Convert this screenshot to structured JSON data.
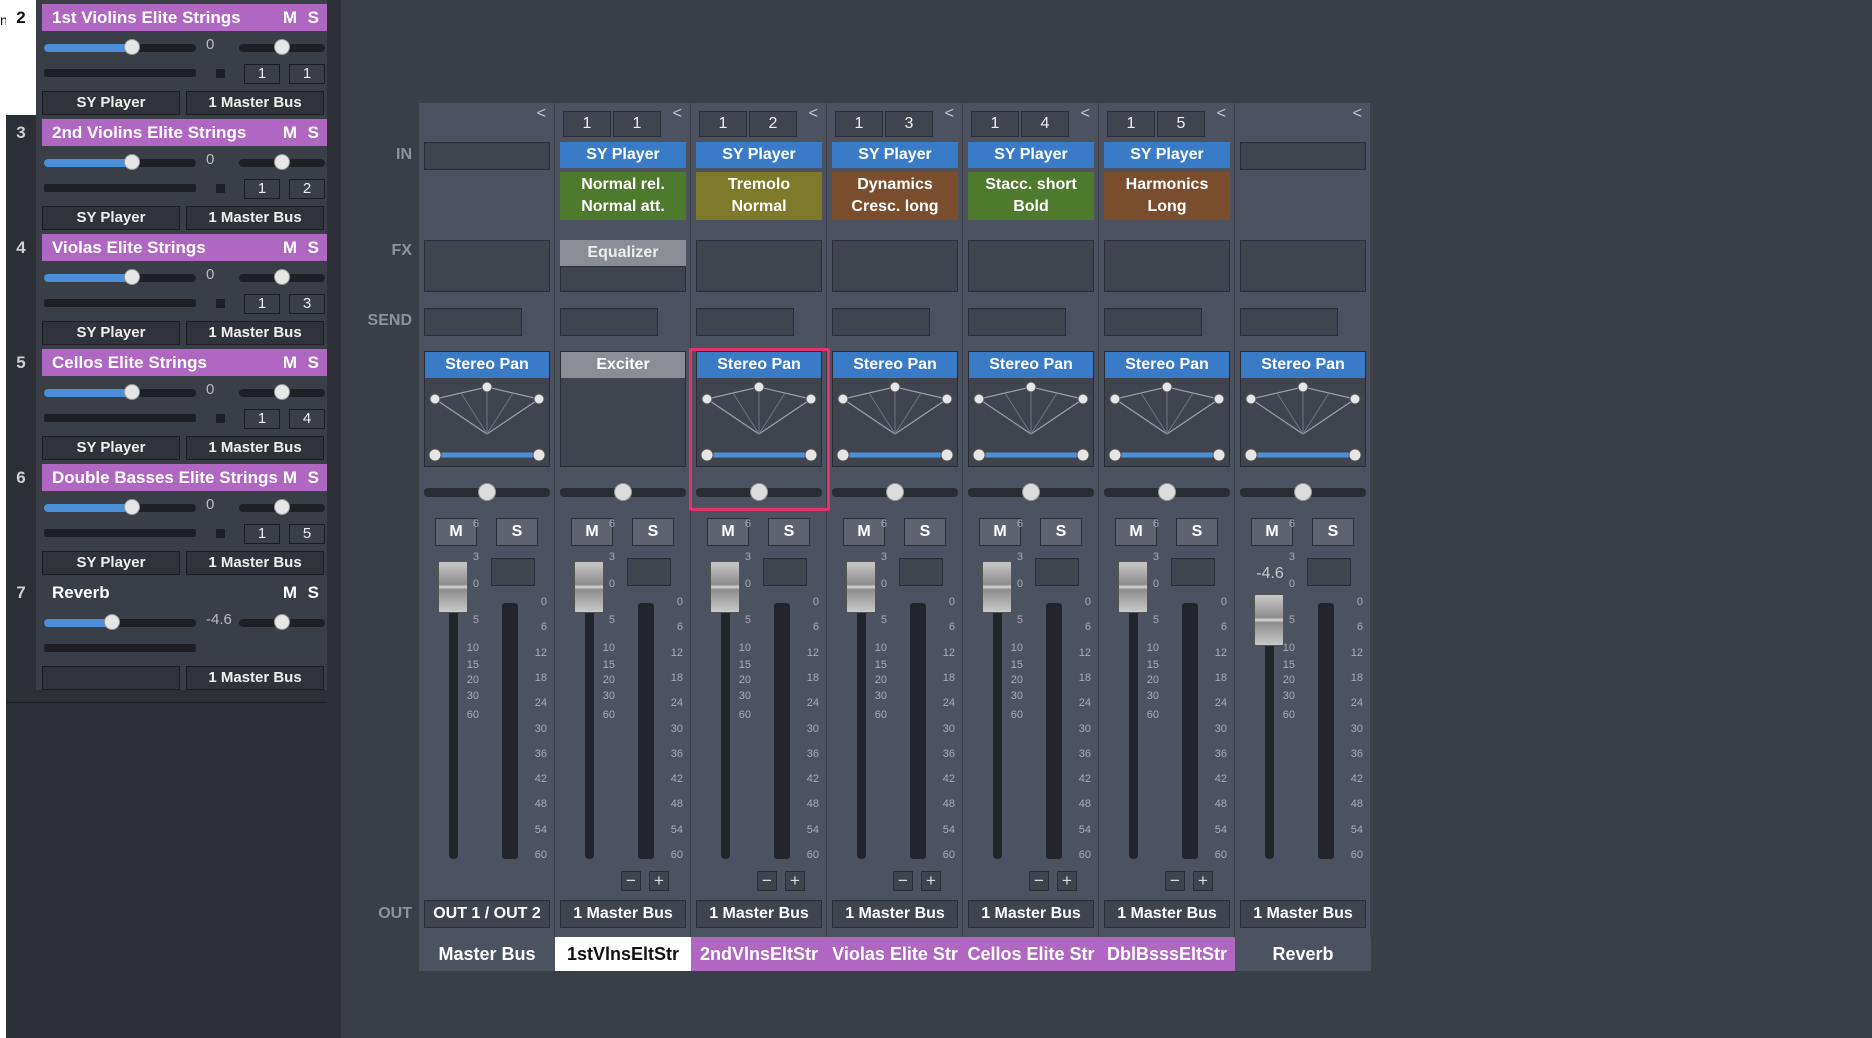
{
  "edge_text": "n",
  "tracks": [
    {
      "num": "2",
      "name": "1st Violins Elite Strings",
      "vol": "0",
      "ch_a": "1",
      "ch_b": "1",
      "input": "SY Player",
      "output": "1 Master Bus",
      "mute": "M",
      "solo": "S"
    },
    {
      "num": "3",
      "name": "2nd Violins Elite Strings",
      "vol": "0",
      "ch_a": "1",
      "ch_b": "2",
      "input": "SY Player",
      "output": "1 Master Bus",
      "mute": "M",
      "solo": "S"
    },
    {
      "num": "4",
      "name": "Violas Elite Strings",
      "vol": "0",
      "ch_a": "1",
      "ch_b": "3",
      "input": "SY Player",
      "output": "1 Master Bus",
      "mute": "M",
      "solo": "S"
    },
    {
      "num": "5",
      "name": "Cellos Elite Strings",
      "vol": "0",
      "ch_a": "1",
      "ch_b": "4",
      "input": "SY Player",
      "output": "1 Master Bus",
      "mute": "M",
      "solo": "S"
    },
    {
      "num": "6",
      "name": "Double Basses Elite Strings",
      "vol": "0",
      "ch_a": "1",
      "ch_b": "5",
      "input": "SY Player",
      "output": "1 Master Bus",
      "mute": "M",
      "solo": "S"
    },
    {
      "num": "7",
      "name": "Reverb",
      "vol": "-4.6",
      "input": "",
      "output": "1 Master Bus",
      "mute": "M",
      "solo": "S"
    }
  ],
  "labels": {
    "in": "IN",
    "fx": "FX",
    "send": "SEND",
    "out": "OUT",
    "collapse": "<",
    "minus": "−",
    "plus": "+"
  },
  "fader_scale": [
    "6",
    "3",
    "0",
    "5",
    "10",
    "15",
    "20",
    "30",
    "60"
  ],
  "meter_scale": [
    "0",
    "6",
    "12",
    "18",
    "24",
    "30",
    "36",
    "42",
    "48",
    "54",
    "60"
  ],
  "strips": [
    {
      "name": "Master Bus",
      "out": "OUT 1 / OUT 2",
      "pan_label": "Stereo Pan",
      "mute": "M",
      "solo": "S",
      "gain": "0",
      "fader_db": 0
    },
    {
      "name": "1stVlnsEltStr",
      "ch_a": "1",
      "ch_b": "1",
      "insert": "SY Player",
      "art": [
        "Normal rel.",
        "Normal att."
      ],
      "art_color": "#4e7a2e",
      "fx": "Equalizer",
      "pan_label": "Exciter",
      "out": "1 Master Bus",
      "mute": "M",
      "solo": "S",
      "gain": "0",
      "fader_db": 0
    },
    {
      "name": "2ndVlnsEltStr",
      "ch_a": "1",
      "ch_b": "2",
      "insert": "SY Player",
      "art": [
        "Tremolo",
        "Normal"
      ],
      "art_color": "#7d7a2a",
      "pan_label": "Stereo Pan",
      "out": "1 Master Bus",
      "mute": "M",
      "solo": "S",
      "gain": "0",
      "fader_db": 0
    },
    {
      "name": "Violas Elite Str",
      "ch_a": "1",
      "ch_b": "3",
      "insert": "SY Player",
      "art": [
        "Dynamics",
        "Cresc. long"
      ],
      "art_color": "#7a4e2c",
      "pan_label": "Stereo Pan",
      "out": "1 Master Bus",
      "mute": "M",
      "solo": "S",
      "gain": "0",
      "fader_db": 0
    },
    {
      "name": "Cellos Elite Str",
      "ch_a": "1",
      "ch_b": "4",
      "insert": "SY Player",
      "art": [
        "Stacc. short",
        "Bold"
      ],
      "art_color": "#4e7a2e",
      "pan_label": "Stereo Pan",
      "out": "1 Master Bus",
      "mute": "M",
      "solo": "S",
      "gain": "0",
      "fader_db": 0
    },
    {
      "name": "DblBsssEltStr",
      "ch_a": "1",
      "ch_b": "5",
      "insert": "SY Player",
      "art": [
        "Harmonics",
        "Long"
      ],
      "art_color": "#7a4e2c",
      "pan_label": "Stereo Pan",
      "out": "1 Master Bus",
      "mute": "M",
      "solo": "S",
      "gain": "0",
      "fader_db": 0
    },
    {
      "name": "Reverb",
      "pan_label": "Stereo Pan",
      "out": "1 Master Bus",
      "mute": "M",
      "solo": "S",
      "gain": "-4.6",
      "fader_db": -4.6
    }
  ],
  "colors": {
    "track_purple": "#b067c1",
    "insert_blue": "#3a7bc8",
    "highlight": "#e0356a",
    "selected_strip_name_bg": "#ffffff"
  }
}
